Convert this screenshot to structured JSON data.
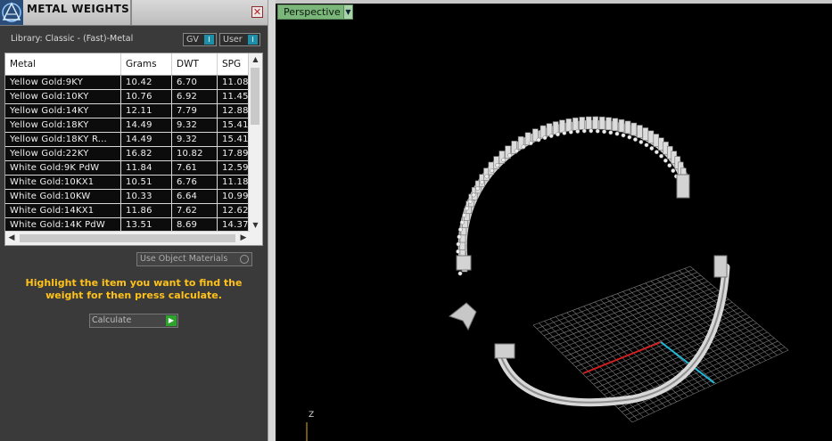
{
  "panel": {
    "title": "METAL WEIGHTS",
    "close_glyph": "✕",
    "library_label": "Library: Classic - (Fast)-Metal",
    "toggles": [
      {
        "label": "GV",
        "state": "I"
      },
      {
        "label": "User",
        "state": "I"
      }
    ],
    "table": {
      "columns": [
        "Metal",
        "Grams",
        "DWT",
        "SPG"
      ],
      "rows": [
        [
          "Yellow Gold:9KY",
          "10.42",
          "6.70",
          "11.08"
        ],
        [
          "Yellow Gold:10KY",
          "10.76",
          "6.92",
          "11.45"
        ],
        [
          "Yellow Gold:14KY",
          "12.11",
          "7.79",
          "12.88"
        ],
        [
          "Yellow Gold:18KY",
          "14.49",
          "9.32",
          "15.41"
        ],
        [
          "Yellow Gold:18KY R...",
          "14.49",
          "9.32",
          "15.41"
        ],
        [
          "Yellow Gold:22KY",
          "16.82",
          "10.82",
          "17.89"
        ],
        [
          "White Gold:9K PdW",
          "11.84",
          "7.61",
          "12.59"
        ],
        [
          "White Gold:10KX1",
          "10.51",
          "6.76",
          "11.18"
        ],
        [
          "White Gold:10KW",
          "10.33",
          "6.64",
          "10.99"
        ],
        [
          "White Gold:14KX1",
          "11.86",
          "7.62",
          "12.62"
        ],
        [
          "White Gold:14K PdW",
          "13.51",
          "8.69",
          "14.37"
        ]
      ]
    },
    "use_object_materials": "Use Object Materials",
    "hint": "Highlight the item you want to find the weight for then press calculate.",
    "calculate_label": "Calculate"
  },
  "viewport": {
    "view_name": "Perspective",
    "axis_label": "Z"
  },
  "icons": {
    "logo": "app-logo-icon",
    "close": "close-icon",
    "scroll_up": "▲",
    "scroll_down": "▼",
    "scroll_left": "◀",
    "scroll_right": "▶",
    "dropdown": "▼",
    "go": "▶"
  }
}
